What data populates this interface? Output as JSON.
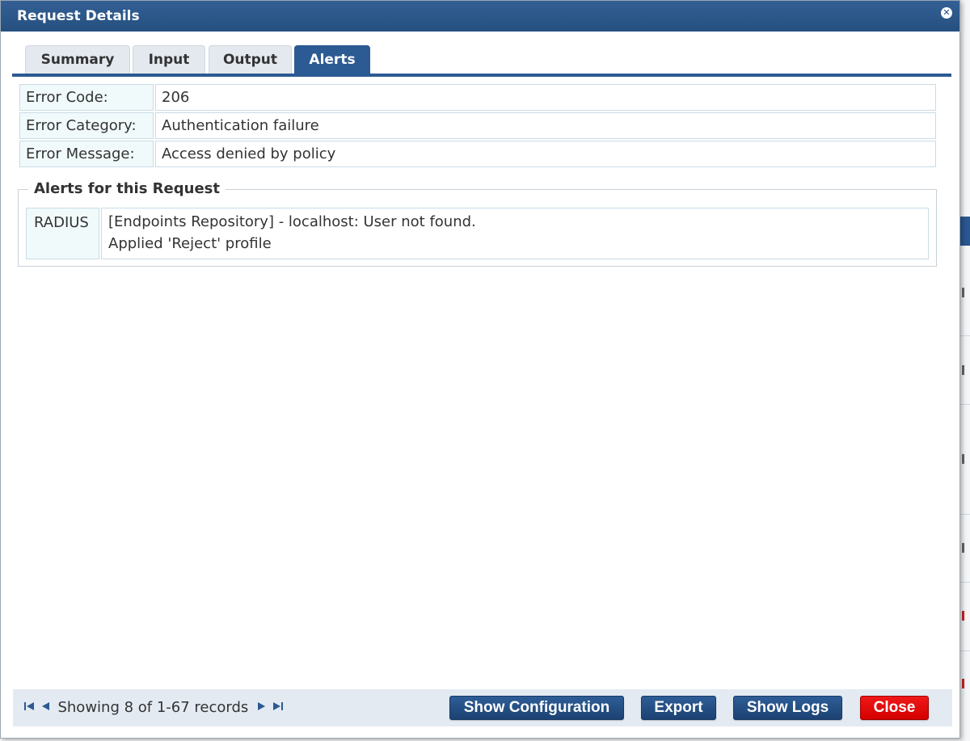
{
  "dialog": {
    "title": "Request Details"
  },
  "tabs": [
    {
      "label": "Summary"
    },
    {
      "label": "Input"
    },
    {
      "label": "Output"
    },
    {
      "label": "Alerts"
    }
  ],
  "active_tab": "Alerts",
  "error_info": {
    "rows": [
      {
        "label": "Error Code:",
        "value": "206"
      },
      {
        "label": "Error Category:",
        "value": "Authentication failure"
      },
      {
        "label": "Error Message:",
        "value": "Access denied by policy"
      }
    ]
  },
  "alerts": {
    "legend": "Alerts for this Request",
    "items": [
      {
        "type": "RADIUS",
        "message_lines": [
          "[Endpoints Repository] - localhost: User not found.",
          "Applied 'Reject' profile"
        ]
      }
    ]
  },
  "footer": {
    "status_text": "Showing 8 of 1-67 records",
    "buttons": {
      "show_configuration": "Show Configuration",
      "export": "Export",
      "show_logs": "Show Logs",
      "close": "Close"
    }
  },
  "colors": {
    "accent": "#2c5a92",
    "close_button": "#e60000"
  }
}
